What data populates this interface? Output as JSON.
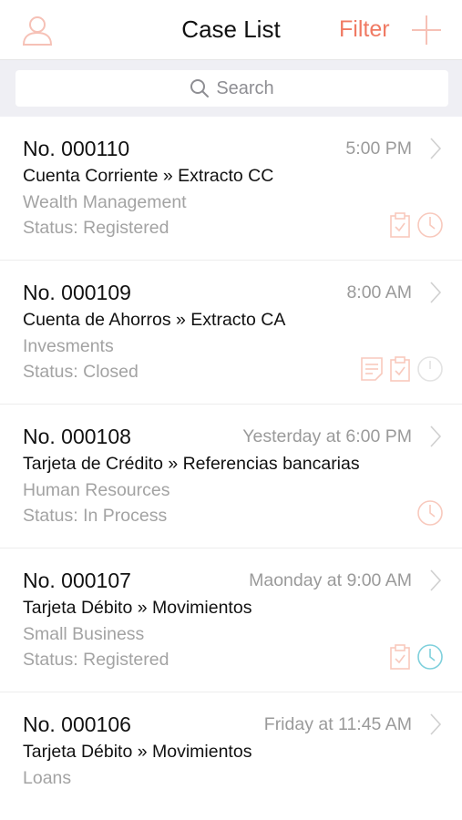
{
  "header": {
    "title": "Case List",
    "filter_label": "Filter",
    "profile_icon": "person-icon",
    "add_icon": "plus-icon"
  },
  "search": {
    "placeholder": "Search",
    "icon": "search-icon"
  },
  "colors": {
    "accent": "#f07a63",
    "icon_faded": "#f8c9bd",
    "icon_info": "#7fd0dc",
    "secondary_text": "#a3a3a3"
  },
  "cases": [
    {
      "number": "No. 000110",
      "time": "5:00 PM",
      "subject": "Cuenta Corriente » Extracto CC",
      "department": "Wealth Management",
      "status": "Status: Registered",
      "icons": [
        "clipboard-check-icon",
        "clock-icon"
      ]
    },
    {
      "number": "No. 000109",
      "time": "8:00 AM",
      "subject": "Cuenta de Ahorros » Extracto CA",
      "department": "Invesments",
      "status": "Status: Closed",
      "icons": [
        "notes-icon",
        "clipboard-check-icon",
        "clock-icon"
      ]
    },
    {
      "number": "No. 000108",
      "time": "Yesterday at 6:00 PM",
      "subject": "Tarjeta de Crédito » Referencias bancarias",
      "department": "Human Resources",
      "status": "Status: In Process",
      "icons": [
        "clock-icon"
      ]
    },
    {
      "number": "No. 000107",
      "time": "Maonday at 9:00 AM",
      "subject": "Tarjeta Débito » Movimientos",
      "department": "Small Business",
      "status": "Status: Registered",
      "icons": [
        "clipboard-check-icon",
        "clock-icon-active"
      ]
    },
    {
      "number": "No. 000106",
      "time": "Friday at 11:45 AM",
      "subject": "Tarjeta Débito » Movimientos",
      "department": "Loans",
      "status": "",
      "icons": []
    }
  ]
}
